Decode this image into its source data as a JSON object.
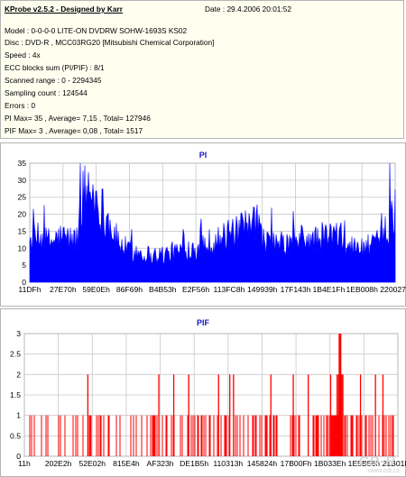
{
  "info": {
    "title": "KProbe v2.5.2 - Designed by Karr",
    "date": "Date : 29.4.2006 20:01:52",
    "lines": [
      "Model : 0-0-0-0 LITE-ON DVDRW SOHW-1693S KS02",
      "Disc : DVD-R , MCC03RG20 [Mitsubishi Chemical Corporation]",
      "Speed : 4x",
      "ECC blocks sum (PI/PIF) : 8/1",
      "Scanned range : 0 - 2294345",
      "Sampling count : 124544",
      "Errors : 0",
      "PI Max= 35 , Average= 7,15 , Total= 127946",
      "PIF Max= 3 , Average= 0,08 , Total= 1517"
    ]
  },
  "colors": {
    "plot": "#0000ff",
    "pif": "#ff0000",
    "grid": "#c8c8c8",
    "title": "#1414c8"
  },
  "watermark": {
    "text": "CD-R",
    "site": "www.cdr.cz"
  },
  "chart_data": [
    {
      "type": "area",
      "title": "PI",
      "x_tick_labels": [
        "11DFh",
        "27E70h",
        "59E0Eh",
        "86F69h",
        "B4B53h",
        "E2F56h",
        "113FC8h",
        "149939h",
        "17F143h",
        "1B4E1Fh",
        "1EB008h",
        "220027h"
      ],
      "y_ticks": [
        0,
        5,
        10,
        15,
        20,
        25,
        30,
        35
      ],
      "ylim": [
        0,
        35
      ],
      "grid": true,
      "max": 35,
      "average": 7.15,
      "profile": [
        [
          0,
          12
        ],
        [
          2,
          13
        ],
        [
          4,
          12
        ],
        [
          6,
          12
        ],
        [
          8,
          13
        ],
        [
          10,
          13
        ],
        [
          12,
          12
        ],
        [
          13,
          13
        ],
        [
          14,
          24
        ],
        [
          15,
          26
        ],
        [
          16,
          27
        ],
        [
          17,
          27
        ],
        [
          18,
          25
        ],
        [
          19,
          23
        ],
        [
          20,
          21
        ],
        [
          22,
          17
        ],
        [
          24,
          12
        ],
        [
          26,
          10
        ],
        [
          28,
          9
        ],
        [
          30,
          9
        ],
        [
          33,
          8
        ],
        [
          36,
          8
        ],
        [
          40,
          9
        ],
        [
          44,
          10
        ],
        [
          47,
          11
        ],
        [
          50,
          12
        ],
        [
          53,
          13
        ],
        [
          56,
          14
        ],
        [
          58,
          15
        ],
        [
          60,
          16
        ],
        [
          62,
          17
        ],
        [
          63,
          15
        ],
        [
          64,
          12
        ],
        [
          67,
          11
        ],
        [
          70,
          11
        ],
        [
          73,
          12
        ],
        [
          75,
          13
        ],
        [
          77,
          12
        ],
        [
          80,
          13
        ],
        [
          83,
          14
        ],
        [
          85,
          13
        ],
        [
          87,
          11
        ],
        [
          89,
          10
        ],
        [
          92,
          10
        ],
        [
          94,
          11
        ],
        [
          96,
          12
        ],
        [
          98,
          13
        ],
        [
          100,
          19
        ]
      ]
    },
    {
      "type": "bar",
      "title": "PIF",
      "x_tick_labels": [
        "11h",
        "202E2h",
        "52E02h",
        "815E4h",
        "AF323h",
        "DE1B5h",
        "110313h",
        "145824h",
        "17B00Fh",
        "1B033Eh",
        "1E5B56h",
        "21B01Fh"
      ],
      "y_ticks": [
        0,
        0.5,
        1,
        1.5,
        2,
        2.5,
        3
      ],
      "ylim": [
        0,
        3
      ],
      "grid": true,
      "max": 3,
      "average": 0.08
    }
  ]
}
